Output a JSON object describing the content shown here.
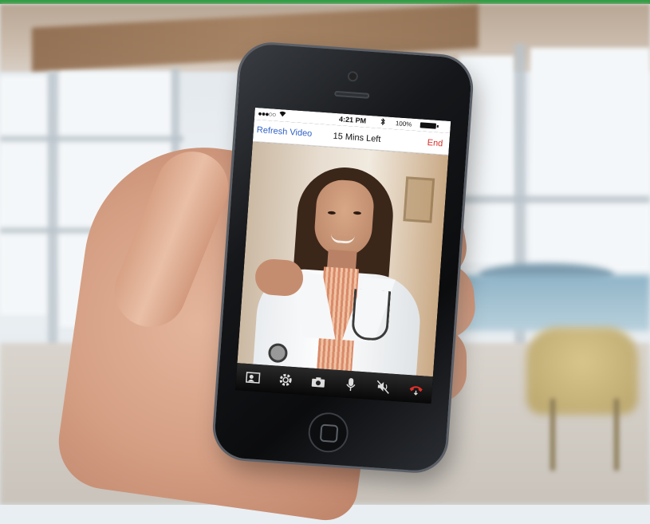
{
  "status_bar": {
    "signal": "●●●○○",
    "time": "4:21 PM",
    "battery_percent": "100%"
  },
  "nav_bar": {
    "left_button": "Refresh Video",
    "title": "15 Mins Left",
    "right_button": "End"
  },
  "toolbar": {
    "icons": [
      "switch-camera-icon",
      "settings-icon",
      "camera-icon",
      "microphone-icon",
      "mute-speaker-icon",
      "hang-up-icon"
    ]
  },
  "colors": {
    "accent_blue": "#2f5fc4",
    "end_red": "#d8302a",
    "top_stripe": "#2f9e44"
  }
}
